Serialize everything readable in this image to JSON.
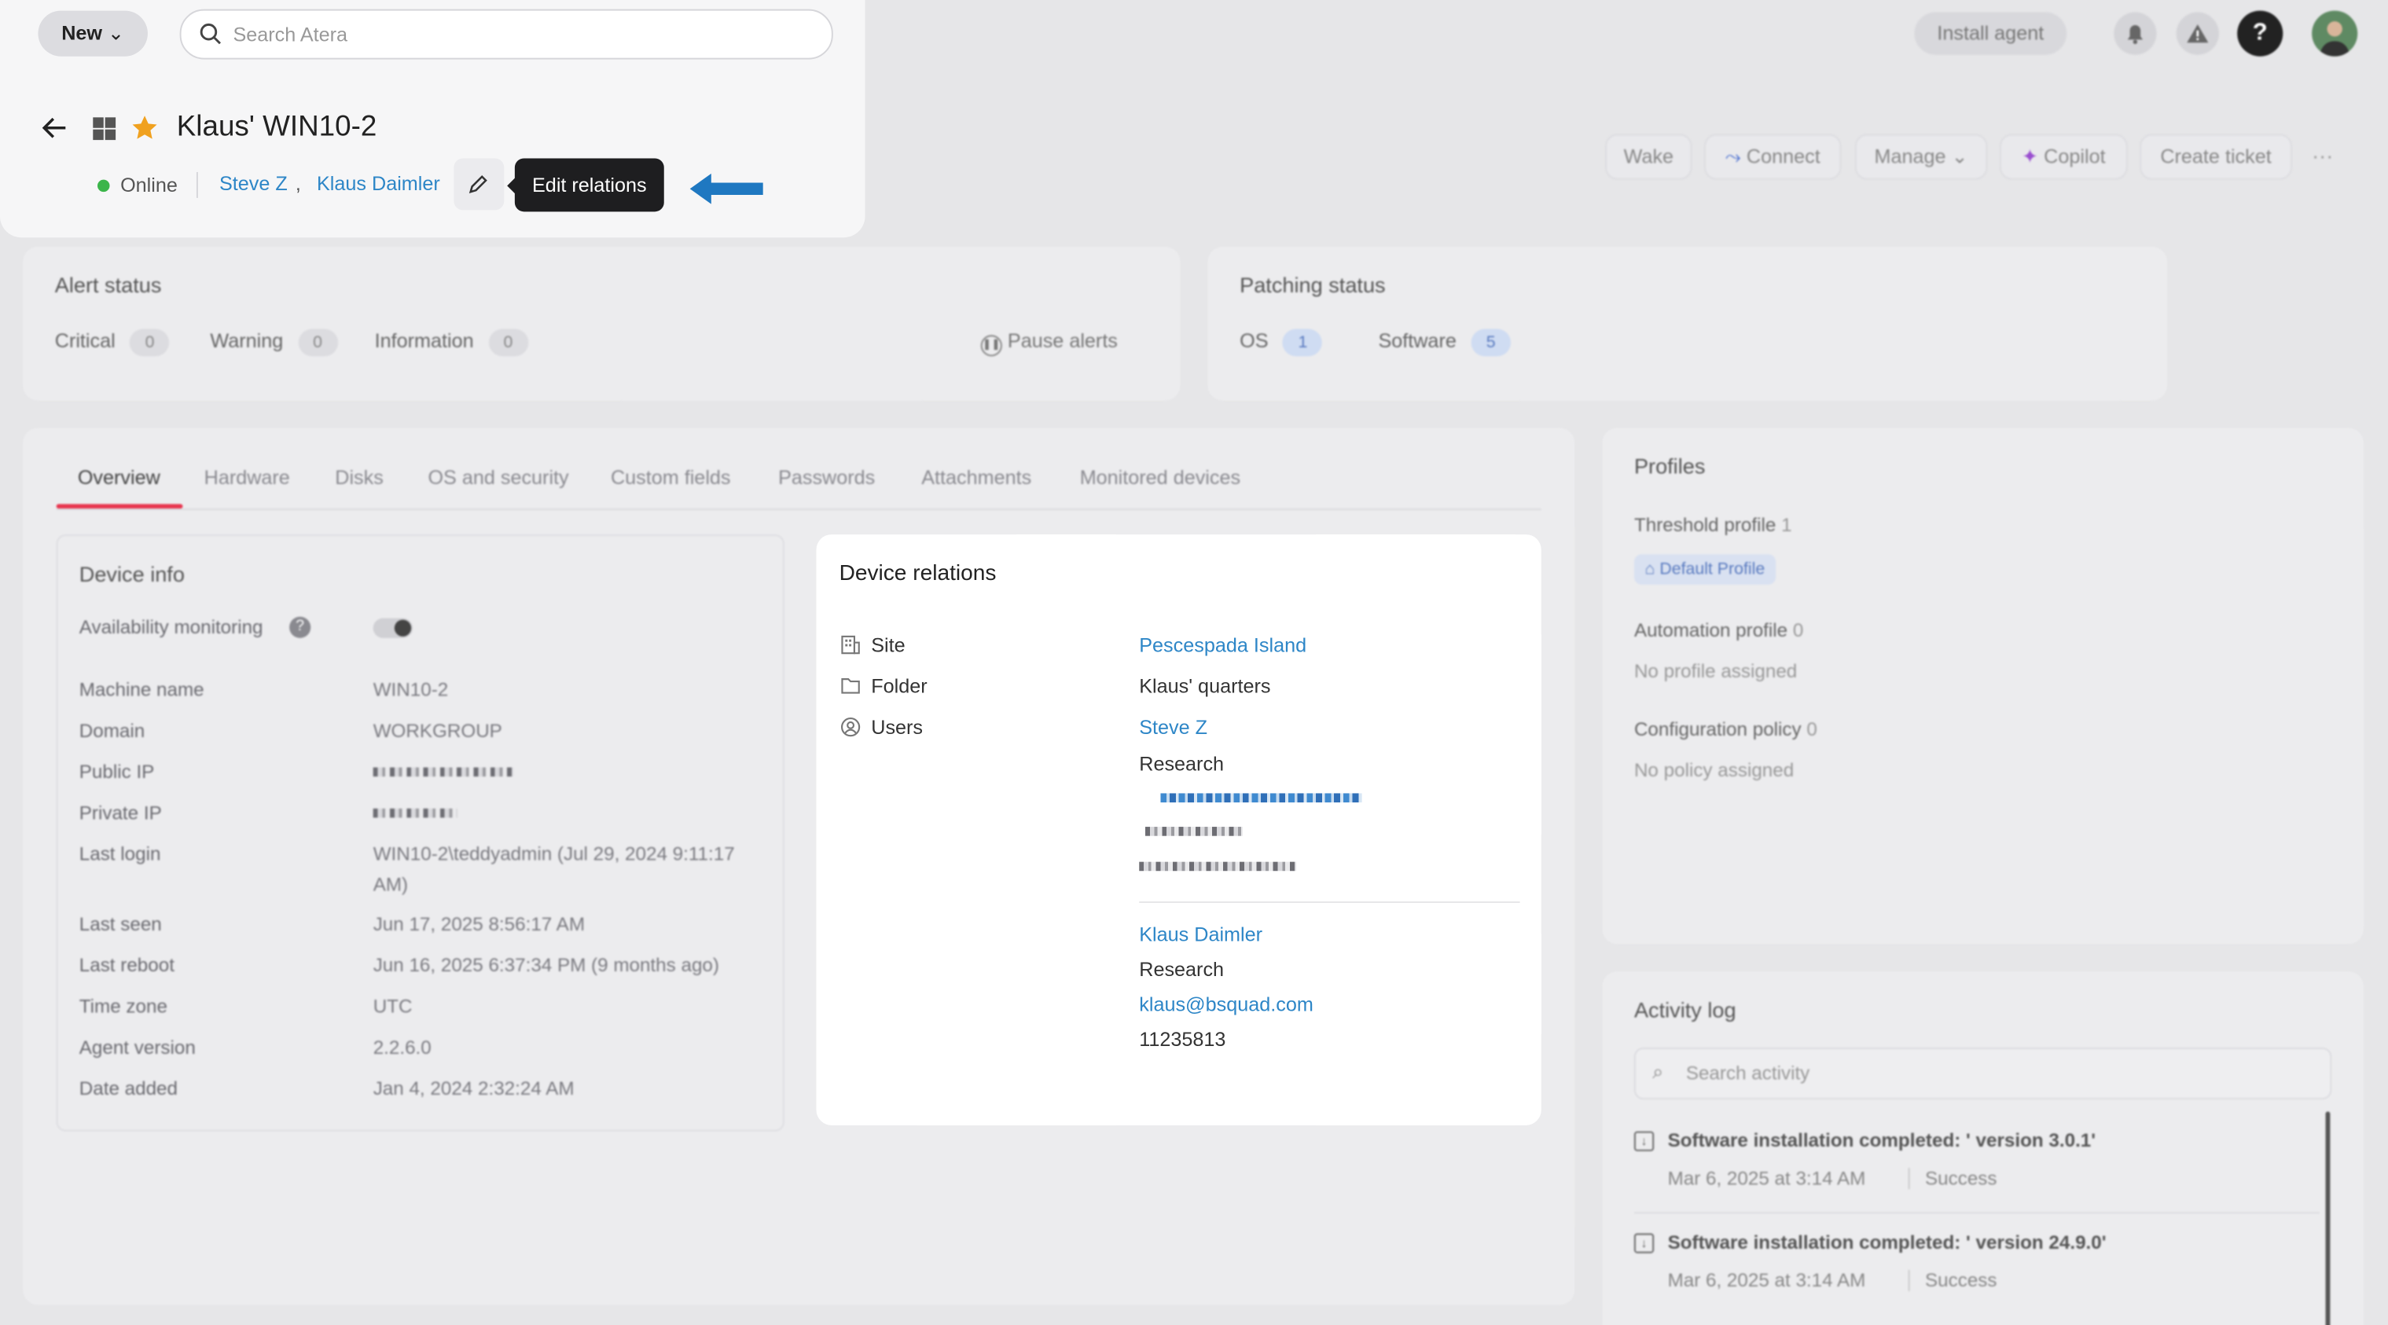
{
  "topbar": {
    "new_label": "New",
    "search_placeholder": "Search Atera",
    "install_agent": "Install agent"
  },
  "device": {
    "title": "Klaus' WIN10-2",
    "status": "Online",
    "users": [
      "Steve Z",
      "Klaus Daimler"
    ],
    "separator": ",",
    "tooltip": "Edit relations"
  },
  "actions": {
    "wake": "Wake",
    "connect": "Connect",
    "manage": "Manage",
    "copilot": "Copilot",
    "create_ticket": "Create ticket",
    "more": "···"
  },
  "alert_status": {
    "title": "Alert status",
    "critical": "Critical",
    "critical_count": "0",
    "warning": "Warning",
    "warning_count": "0",
    "information": "Information",
    "information_count": "0",
    "pause": "Pause alerts"
  },
  "patching_status": {
    "title": "Patching status",
    "os": "OS",
    "os_count": "1",
    "software": "Software",
    "software_count": "5"
  },
  "tabs": [
    "Overview",
    "Hardware",
    "Disks",
    "OS and security",
    "Custom fields",
    "Passwords",
    "Attachments",
    "Monitored devices"
  ],
  "device_info": {
    "title": "Device info",
    "availability": "Availability monitoring",
    "rows": [
      {
        "label": "Machine name",
        "value": "WIN10-2"
      },
      {
        "label": "Domain",
        "value": "WORKGROUP"
      },
      {
        "label": "Public IP",
        "value": ""
      },
      {
        "label": "Private IP",
        "value": ""
      },
      {
        "label": "Last login",
        "value": "WIN10-2\\teddyadmin (Jul 29, 2024 9:11:17",
        "value2": "AM)"
      },
      {
        "label": "Last seen",
        "value": "Jun 17, 2025 8:56:17 AM"
      },
      {
        "label": "Last reboot",
        "value": "Jun 16, 2025 6:37:34 PM (9 months ago)"
      },
      {
        "label": "Time zone",
        "value": "UTC"
      },
      {
        "label": "Agent version",
        "value": "2.2.6.0"
      },
      {
        "label": "Date added",
        "value": "Jan 4, 2024 2:32:24 AM"
      }
    ]
  },
  "relations": {
    "title": "Device relations",
    "site_label": "Site",
    "site": "Pescespada Island",
    "folder_label": "Folder",
    "folder": "Klaus' quarters",
    "users_label": "Users",
    "user1": {
      "name": "Steve Z",
      "dept": "Research"
    },
    "user2": {
      "name": "Klaus Daimler",
      "dept": "Research",
      "email": "klaus@bsquad.com",
      "phone": "11235813"
    }
  },
  "profiles": {
    "title": "Profiles",
    "threshold": "Threshold profile",
    "threshold_count": "1",
    "default_profile": "Default Profile",
    "automation": "Automation profile",
    "automation_count": "0",
    "no_profile": "No profile assigned",
    "config": "Configuration policy",
    "config_count": "0",
    "no_policy": "No policy assigned"
  },
  "activity": {
    "title": "Activity log",
    "search_placeholder": "Search activity",
    "items": [
      {
        "text": "Software installation completed: ' version 3.0.1'",
        "date": "Mar 6, 2025 at 3:14 AM",
        "status": "Success"
      },
      {
        "text": "Software installation completed: ' version 24.9.0'",
        "date": "Mar 6, 2025 at 3:14 AM",
        "status": "Success"
      }
    ]
  },
  "colors": {
    "accent": "#2d86c7",
    "online": "#3bb54a",
    "star": "#f0a11f",
    "tab_underline": "#e8364f",
    "arrow": "#1f78c1"
  }
}
